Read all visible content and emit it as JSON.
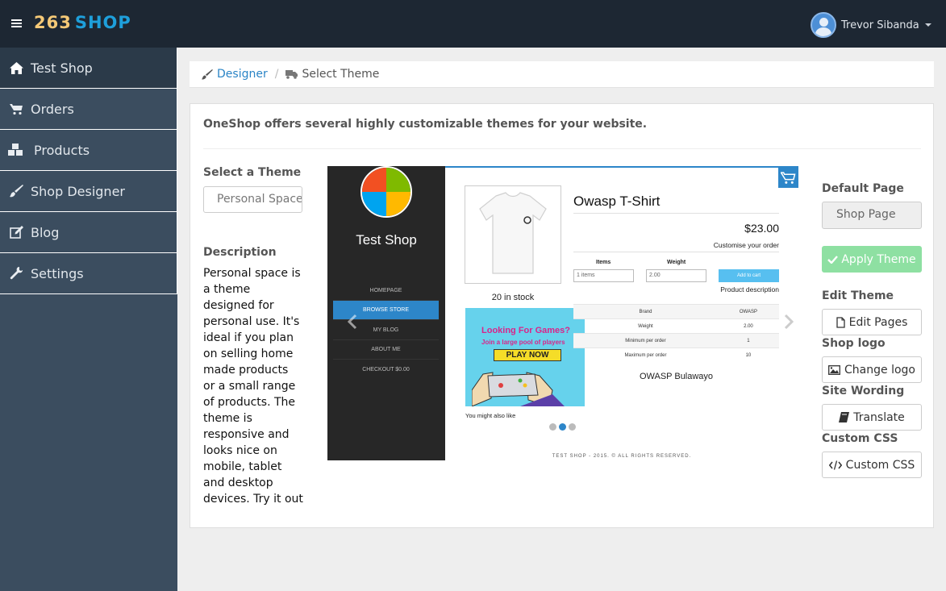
{
  "brand": {
    "number": "263",
    "name": "SHOP"
  },
  "user": {
    "name": "Trevor Sibanda"
  },
  "sidebar": {
    "items": [
      {
        "label": "Test Shop",
        "icon": "home-icon"
      },
      {
        "label": "Orders",
        "icon": "cart-icon"
      },
      {
        "label": "Products",
        "icon": "cubes-icon"
      },
      {
        "label": "Shop Designer",
        "icon": "brush-icon"
      },
      {
        "label": "Blog",
        "icon": "edit-icon"
      },
      {
        "label": "Settings",
        "icon": "wrench-icon"
      }
    ]
  },
  "breadcrumb": {
    "parent": "Designer",
    "current": "Select Theme"
  },
  "main": {
    "intro": "OneShop offers several highly customizable themes for your website.",
    "select_theme_label": "Select a Theme",
    "theme_value": "Personal Space",
    "description_label": "Description",
    "description": "Personal space is a theme designed for personal use. It's ideal if you plan on selling home made products or a small range of products. The theme is responsive and looks nice on mobile, tablet and desktop devices. Try it out"
  },
  "preview": {
    "shop_title": "Test Shop",
    "nav": [
      "HOMEPAGE",
      "BROWSE STORE",
      "MY BLOG",
      "ABOUT ME",
      "CHECKOUT $0.00"
    ],
    "product_name": "Owasp T-Shirt",
    "price": "$23.00",
    "customise": "Customise your order",
    "field_items": "Items",
    "field_weight": "Weight",
    "items_value": "1 items",
    "weight_value": "2.00",
    "add_to_cart": "Add to cart",
    "product_description": "Product description",
    "stock": "20 in stock",
    "ad_title": "Looking For Games?",
    "ad_sub": "Join a large pool of players",
    "ad_button": "PLAY NOW",
    "also_like": "You might also like",
    "table": [
      [
        "Brand",
        "OWASP"
      ],
      [
        "Weight",
        "2.00"
      ],
      [
        "Minimum per order",
        "1"
      ],
      [
        "Maximum per order",
        "10"
      ]
    ],
    "store_name": "OWASP Bulawayo",
    "footer": "TEST SHOP - 2015. © ALL RIGHTS RESERVED."
  },
  "right": {
    "default_page_label": "Default Page",
    "default_page_value": "Shop Page",
    "apply_button": "Apply Theme",
    "edit_theme_label": "Edit Theme",
    "edit_pages_button": "Edit Pages",
    "shop_logo_label": "Shop logo",
    "change_logo_button": "Change logo",
    "site_wording_label": "Site Wording",
    "translate_button": "Translate",
    "custom_css_label": "Custom CSS",
    "custom_css_button": "Custom CSS"
  },
  "colors": {
    "topbar": "#1d2733",
    "sidebar": "#3b4d5f",
    "brand_number": "#f5c977",
    "brand_name": "#1e9fdb",
    "link": "#2a84c6",
    "apply_button": "#8ee0a2",
    "preview_accent": "#2d86c9"
  }
}
